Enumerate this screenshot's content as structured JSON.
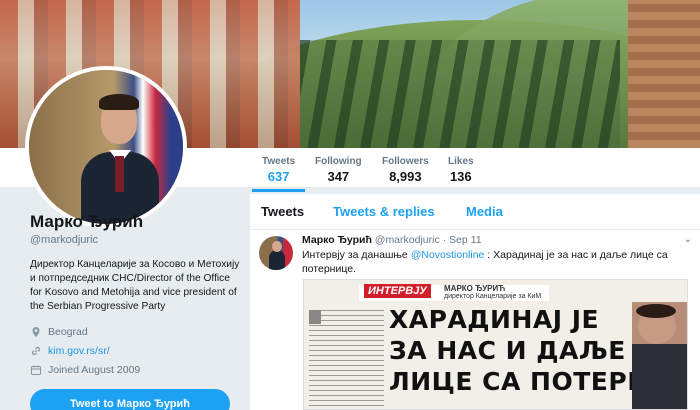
{
  "profile": {
    "name": "Марко Ђурић",
    "handle": "@markodjuric",
    "bio": "Директор Канцеларије за Косово и Метохију и потпредседник СНС/Director of the Office for Kosovo and Metohija and vice president of the Serbian Progressive Party",
    "location": "Beograd",
    "website": "kim.gov.rs/sr/",
    "joined": "Joined August 2009",
    "tweet_to_label": "Tweet to Марко Ђурић"
  },
  "stats": [
    {
      "label": "Tweets",
      "value": "637"
    },
    {
      "label": "Following",
      "value": "347"
    },
    {
      "label": "Followers",
      "value": "8,993"
    },
    {
      "label": "Likes",
      "value": "136"
    }
  ],
  "tabs": [
    "Tweets",
    "Tweets & replies",
    "Media"
  ],
  "tweet": {
    "name": "Марко Ђурић",
    "handle": "@markodjuric",
    "date": "· Sep 11",
    "text_before": "Интервју за данашње ",
    "mention": "@Novostionline",
    "text_after": " : Харадинај је за нас и даље лице са потернице.",
    "image": {
      "tag": "ИНТЕРВЈУ",
      "author": "МАРКО ЂУРИЋ",
      "author_role": "директор Канцеларије за КиМ",
      "headline": [
        "ХАРАДИНАЈ ЈЕ",
        "ЗА НАС И ДАЉЕ",
        "ЛИЦЕ СА ПОТЕРНИЦЕ"
      ]
    }
  },
  "colors": {
    "accent": "#1da1f2",
    "link": "#1b95e0",
    "muted": "#657786",
    "news_red": "#d21f2a"
  },
  "icons": {
    "location": "map-pin-icon",
    "website": "link-icon",
    "joined": "calendar-icon",
    "caret": "chevron-down-icon"
  }
}
